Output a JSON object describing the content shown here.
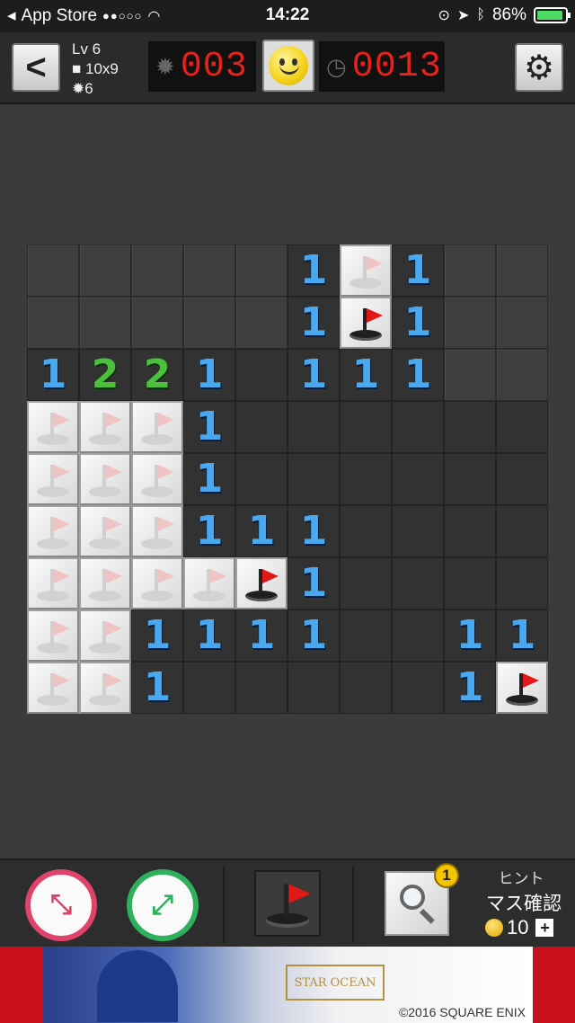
{
  "status_bar": {
    "carrier": "App Store",
    "time": "14:22",
    "battery": "86%"
  },
  "toolbar": {
    "level": "Lv 6",
    "board_size": "10x9",
    "mine_total": "6",
    "mines_left": "003",
    "elapsed": "0013"
  },
  "board": {
    "cols": 10,
    "rows": 9,
    "cells": [
      [
        "h",
        "h",
        "h",
        "h",
        "h",
        "1",
        "g",
        "1",
        "h",
        "h"
      ],
      [
        "h",
        "h",
        "h",
        "h",
        "h",
        "1",
        "f",
        "1",
        "h",
        "h"
      ],
      [
        "1",
        "2",
        "2",
        "1",
        "e",
        "1",
        "1",
        "1",
        "h",
        "h"
      ],
      [
        "g",
        "g",
        "g",
        "1",
        "e",
        "e",
        "e",
        "e",
        "e",
        "e"
      ],
      [
        "g",
        "g",
        "g",
        "1",
        "e",
        "e",
        "e",
        "e",
        "e",
        "e"
      ],
      [
        "g",
        "g",
        "g",
        "1",
        "1",
        "1",
        "e",
        "e",
        "e",
        "e"
      ],
      [
        "g",
        "g",
        "g",
        "g",
        "f",
        "1",
        "e",
        "e",
        "e",
        "e"
      ],
      [
        "g",
        "g",
        "1",
        "1",
        "1",
        "1",
        "e",
        "e",
        "1",
        "1"
      ],
      [
        "g",
        "g",
        "1",
        "e",
        "e",
        "e",
        "e",
        "e",
        "1",
        "f"
      ]
    ]
  },
  "bottom_bar": {
    "hint_badge": "1",
    "hint_title": "ヒント",
    "hint_desc": "マス確認",
    "hint_cost": "10",
    "plus": "+"
  },
  "ad": {
    "logo_text": "STAR OCEAN",
    "copyright": "©2016 SQUARE ENIX"
  }
}
